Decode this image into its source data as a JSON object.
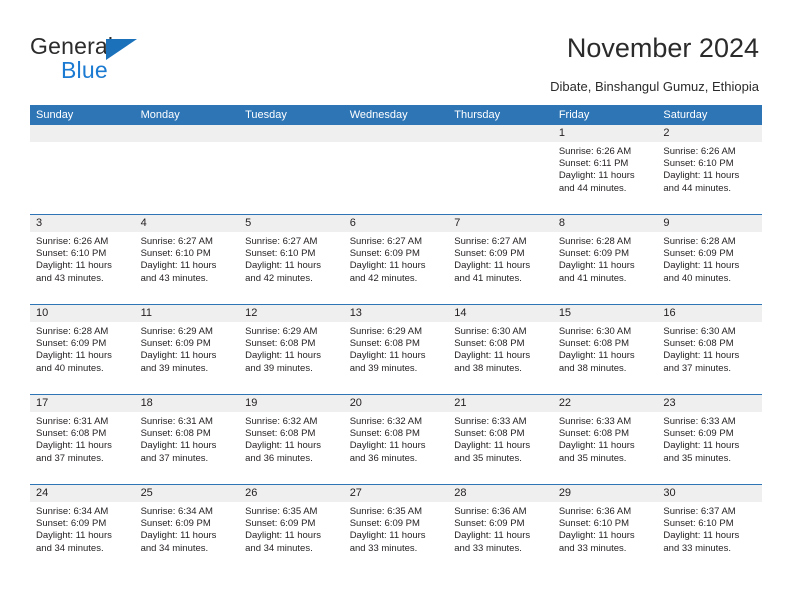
{
  "brand": {
    "name_part1": "General",
    "name_part2": "Blue",
    "triangle_color": "#1b72bb",
    "blue_color": "#1b7ad1"
  },
  "header": {
    "title": "November 2024",
    "subtitle": "Dibate, Binshangul Gumuz, Ethiopia"
  },
  "colors": {
    "header_blue": "#2e75b6",
    "daynum_gray": "#efefef",
    "text": "#231f20"
  },
  "calendar": {
    "weekday_headers": [
      "Sunday",
      "Monday",
      "Tuesday",
      "Wednesday",
      "Thursday",
      "Friday",
      "Saturday"
    ],
    "weeks": [
      [
        {
          "day": "",
          "sunrise": "",
          "sunset": "",
          "daylight_line1": "",
          "daylight_line2": ""
        },
        {
          "day": "",
          "sunrise": "",
          "sunset": "",
          "daylight_line1": "",
          "daylight_line2": ""
        },
        {
          "day": "",
          "sunrise": "",
          "sunset": "",
          "daylight_line1": "",
          "daylight_line2": ""
        },
        {
          "day": "",
          "sunrise": "",
          "sunset": "",
          "daylight_line1": "",
          "daylight_line2": ""
        },
        {
          "day": "",
          "sunrise": "",
          "sunset": "",
          "daylight_line1": "",
          "daylight_line2": ""
        },
        {
          "day": "1",
          "sunrise": "Sunrise: 6:26 AM",
          "sunset": "Sunset: 6:11 PM",
          "daylight_line1": "Daylight: 11 hours",
          "daylight_line2": "and 44 minutes."
        },
        {
          "day": "2",
          "sunrise": "Sunrise: 6:26 AM",
          "sunset": "Sunset: 6:10 PM",
          "daylight_line1": "Daylight: 11 hours",
          "daylight_line2": "and 44 minutes."
        }
      ],
      [
        {
          "day": "3",
          "sunrise": "Sunrise: 6:26 AM",
          "sunset": "Sunset: 6:10 PM",
          "daylight_line1": "Daylight: 11 hours",
          "daylight_line2": "and 43 minutes."
        },
        {
          "day": "4",
          "sunrise": "Sunrise: 6:27 AM",
          "sunset": "Sunset: 6:10 PM",
          "daylight_line1": "Daylight: 11 hours",
          "daylight_line2": "and 43 minutes."
        },
        {
          "day": "5",
          "sunrise": "Sunrise: 6:27 AM",
          "sunset": "Sunset: 6:10 PM",
          "daylight_line1": "Daylight: 11 hours",
          "daylight_line2": "and 42 minutes."
        },
        {
          "day": "6",
          "sunrise": "Sunrise: 6:27 AM",
          "sunset": "Sunset: 6:09 PM",
          "daylight_line1": "Daylight: 11 hours",
          "daylight_line2": "and 42 minutes."
        },
        {
          "day": "7",
          "sunrise": "Sunrise: 6:27 AM",
          "sunset": "Sunset: 6:09 PM",
          "daylight_line1": "Daylight: 11 hours",
          "daylight_line2": "and 41 minutes."
        },
        {
          "day": "8",
          "sunrise": "Sunrise: 6:28 AM",
          "sunset": "Sunset: 6:09 PM",
          "daylight_line1": "Daylight: 11 hours",
          "daylight_line2": "and 41 minutes."
        },
        {
          "day": "9",
          "sunrise": "Sunrise: 6:28 AM",
          "sunset": "Sunset: 6:09 PM",
          "daylight_line1": "Daylight: 11 hours",
          "daylight_line2": "and 40 minutes."
        }
      ],
      [
        {
          "day": "10",
          "sunrise": "Sunrise: 6:28 AM",
          "sunset": "Sunset: 6:09 PM",
          "daylight_line1": "Daylight: 11 hours",
          "daylight_line2": "and 40 minutes."
        },
        {
          "day": "11",
          "sunrise": "Sunrise: 6:29 AM",
          "sunset": "Sunset: 6:09 PM",
          "daylight_line1": "Daylight: 11 hours",
          "daylight_line2": "and 39 minutes."
        },
        {
          "day": "12",
          "sunrise": "Sunrise: 6:29 AM",
          "sunset": "Sunset: 6:08 PM",
          "daylight_line1": "Daylight: 11 hours",
          "daylight_line2": "and 39 minutes."
        },
        {
          "day": "13",
          "sunrise": "Sunrise: 6:29 AM",
          "sunset": "Sunset: 6:08 PM",
          "daylight_line1": "Daylight: 11 hours",
          "daylight_line2": "and 39 minutes."
        },
        {
          "day": "14",
          "sunrise": "Sunrise: 6:30 AM",
          "sunset": "Sunset: 6:08 PM",
          "daylight_line1": "Daylight: 11 hours",
          "daylight_line2": "and 38 minutes."
        },
        {
          "day": "15",
          "sunrise": "Sunrise: 6:30 AM",
          "sunset": "Sunset: 6:08 PM",
          "daylight_line1": "Daylight: 11 hours",
          "daylight_line2": "and 38 minutes."
        },
        {
          "day": "16",
          "sunrise": "Sunrise: 6:30 AM",
          "sunset": "Sunset: 6:08 PM",
          "daylight_line1": "Daylight: 11 hours",
          "daylight_line2": "and 37 minutes."
        }
      ],
      [
        {
          "day": "17",
          "sunrise": "Sunrise: 6:31 AM",
          "sunset": "Sunset: 6:08 PM",
          "daylight_line1": "Daylight: 11 hours",
          "daylight_line2": "and 37 minutes."
        },
        {
          "day": "18",
          "sunrise": "Sunrise: 6:31 AM",
          "sunset": "Sunset: 6:08 PM",
          "daylight_line1": "Daylight: 11 hours",
          "daylight_line2": "and 37 minutes."
        },
        {
          "day": "19",
          "sunrise": "Sunrise: 6:32 AM",
          "sunset": "Sunset: 6:08 PM",
          "daylight_line1": "Daylight: 11 hours",
          "daylight_line2": "and 36 minutes."
        },
        {
          "day": "20",
          "sunrise": "Sunrise: 6:32 AM",
          "sunset": "Sunset: 6:08 PM",
          "daylight_line1": "Daylight: 11 hours",
          "daylight_line2": "and 36 minutes."
        },
        {
          "day": "21",
          "sunrise": "Sunrise: 6:33 AM",
          "sunset": "Sunset: 6:08 PM",
          "daylight_line1": "Daylight: 11 hours",
          "daylight_line2": "and 35 minutes."
        },
        {
          "day": "22",
          "sunrise": "Sunrise: 6:33 AM",
          "sunset": "Sunset: 6:08 PM",
          "daylight_line1": "Daylight: 11 hours",
          "daylight_line2": "and 35 minutes."
        },
        {
          "day": "23",
          "sunrise": "Sunrise: 6:33 AM",
          "sunset": "Sunset: 6:09 PM",
          "daylight_line1": "Daylight: 11 hours",
          "daylight_line2": "and 35 minutes."
        }
      ],
      [
        {
          "day": "24",
          "sunrise": "Sunrise: 6:34 AM",
          "sunset": "Sunset: 6:09 PM",
          "daylight_line1": "Daylight: 11 hours",
          "daylight_line2": "and 34 minutes."
        },
        {
          "day": "25",
          "sunrise": "Sunrise: 6:34 AM",
          "sunset": "Sunset: 6:09 PM",
          "daylight_line1": "Daylight: 11 hours",
          "daylight_line2": "and 34 minutes."
        },
        {
          "day": "26",
          "sunrise": "Sunrise: 6:35 AM",
          "sunset": "Sunset: 6:09 PM",
          "daylight_line1": "Daylight: 11 hours",
          "daylight_line2": "and 34 minutes."
        },
        {
          "day": "27",
          "sunrise": "Sunrise: 6:35 AM",
          "sunset": "Sunset: 6:09 PM",
          "daylight_line1": "Daylight: 11 hours",
          "daylight_line2": "and 33 minutes."
        },
        {
          "day": "28",
          "sunrise": "Sunrise: 6:36 AM",
          "sunset": "Sunset: 6:09 PM",
          "daylight_line1": "Daylight: 11 hours",
          "daylight_line2": "and 33 minutes."
        },
        {
          "day": "29",
          "sunrise": "Sunrise: 6:36 AM",
          "sunset": "Sunset: 6:10 PM",
          "daylight_line1": "Daylight: 11 hours",
          "daylight_line2": "and 33 minutes."
        },
        {
          "day": "30",
          "sunrise": "Sunrise: 6:37 AM",
          "sunset": "Sunset: 6:10 PM",
          "daylight_line1": "Daylight: 11 hours",
          "daylight_line2": "and 33 minutes."
        }
      ]
    ]
  }
}
